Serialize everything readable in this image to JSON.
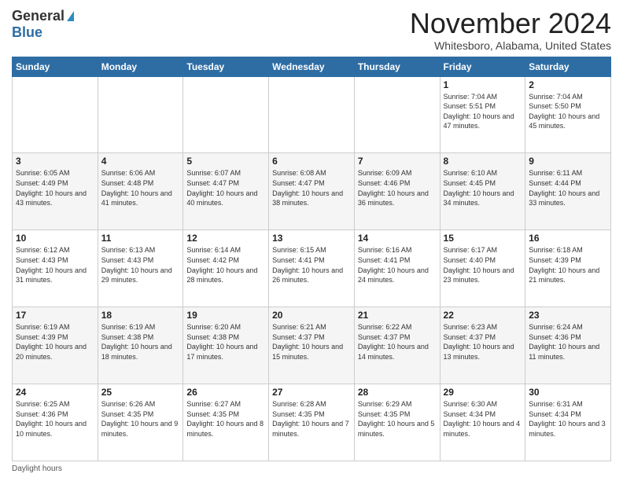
{
  "logo": {
    "line1": "General",
    "line2": "Blue"
  },
  "title": {
    "month_year": "November 2024",
    "location": "Whitesboro, Alabama, United States"
  },
  "days_of_week": [
    "Sunday",
    "Monday",
    "Tuesday",
    "Wednesday",
    "Thursday",
    "Friday",
    "Saturday"
  ],
  "footer": {
    "label": "Daylight hours"
  },
  "weeks": [
    [
      {
        "day": "",
        "sunrise": "",
        "sunset": "",
        "daylight": ""
      },
      {
        "day": "",
        "sunrise": "",
        "sunset": "",
        "daylight": ""
      },
      {
        "day": "",
        "sunrise": "",
        "sunset": "",
        "daylight": ""
      },
      {
        "day": "",
        "sunrise": "",
        "sunset": "",
        "daylight": ""
      },
      {
        "day": "",
        "sunrise": "",
        "sunset": "",
        "daylight": ""
      },
      {
        "day": "1",
        "sunrise": "Sunrise: 7:04 AM",
        "sunset": "Sunset: 5:51 PM",
        "daylight": "Daylight: 10 hours and 47 minutes."
      },
      {
        "day": "2",
        "sunrise": "Sunrise: 7:04 AM",
        "sunset": "Sunset: 5:50 PM",
        "daylight": "Daylight: 10 hours and 45 minutes."
      }
    ],
    [
      {
        "day": "3",
        "sunrise": "Sunrise: 6:05 AM",
        "sunset": "Sunset: 4:49 PM",
        "daylight": "Daylight: 10 hours and 43 minutes."
      },
      {
        "day": "4",
        "sunrise": "Sunrise: 6:06 AM",
        "sunset": "Sunset: 4:48 PM",
        "daylight": "Daylight: 10 hours and 41 minutes."
      },
      {
        "day": "5",
        "sunrise": "Sunrise: 6:07 AM",
        "sunset": "Sunset: 4:47 PM",
        "daylight": "Daylight: 10 hours and 40 minutes."
      },
      {
        "day": "6",
        "sunrise": "Sunrise: 6:08 AM",
        "sunset": "Sunset: 4:47 PM",
        "daylight": "Daylight: 10 hours and 38 minutes."
      },
      {
        "day": "7",
        "sunrise": "Sunrise: 6:09 AM",
        "sunset": "Sunset: 4:46 PM",
        "daylight": "Daylight: 10 hours and 36 minutes."
      },
      {
        "day": "8",
        "sunrise": "Sunrise: 6:10 AM",
        "sunset": "Sunset: 4:45 PM",
        "daylight": "Daylight: 10 hours and 34 minutes."
      },
      {
        "day": "9",
        "sunrise": "Sunrise: 6:11 AM",
        "sunset": "Sunset: 4:44 PM",
        "daylight": "Daylight: 10 hours and 33 minutes."
      }
    ],
    [
      {
        "day": "10",
        "sunrise": "Sunrise: 6:12 AM",
        "sunset": "Sunset: 4:43 PM",
        "daylight": "Daylight: 10 hours and 31 minutes."
      },
      {
        "day": "11",
        "sunrise": "Sunrise: 6:13 AM",
        "sunset": "Sunset: 4:43 PM",
        "daylight": "Daylight: 10 hours and 29 minutes."
      },
      {
        "day": "12",
        "sunrise": "Sunrise: 6:14 AM",
        "sunset": "Sunset: 4:42 PM",
        "daylight": "Daylight: 10 hours and 28 minutes."
      },
      {
        "day": "13",
        "sunrise": "Sunrise: 6:15 AM",
        "sunset": "Sunset: 4:41 PM",
        "daylight": "Daylight: 10 hours and 26 minutes."
      },
      {
        "day": "14",
        "sunrise": "Sunrise: 6:16 AM",
        "sunset": "Sunset: 4:41 PM",
        "daylight": "Daylight: 10 hours and 24 minutes."
      },
      {
        "day": "15",
        "sunrise": "Sunrise: 6:17 AM",
        "sunset": "Sunset: 4:40 PM",
        "daylight": "Daylight: 10 hours and 23 minutes."
      },
      {
        "day": "16",
        "sunrise": "Sunrise: 6:18 AM",
        "sunset": "Sunset: 4:39 PM",
        "daylight": "Daylight: 10 hours and 21 minutes."
      }
    ],
    [
      {
        "day": "17",
        "sunrise": "Sunrise: 6:19 AM",
        "sunset": "Sunset: 4:39 PM",
        "daylight": "Daylight: 10 hours and 20 minutes."
      },
      {
        "day": "18",
        "sunrise": "Sunrise: 6:19 AM",
        "sunset": "Sunset: 4:38 PM",
        "daylight": "Daylight: 10 hours and 18 minutes."
      },
      {
        "day": "19",
        "sunrise": "Sunrise: 6:20 AM",
        "sunset": "Sunset: 4:38 PM",
        "daylight": "Daylight: 10 hours and 17 minutes."
      },
      {
        "day": "20",
        "sunrise": "Sunrise: 6:21 AM",
        "sunset": "Sunset: 4:37 PM",
        "daylight": "Daylight: 10 hours and 15 minutes."
      },
      {
        "day": "21",
        "sunrise": "Sunrise: 6:22 AM",
        "sunset": "Sunset: 4:37 PM",
        "daylight": "Daylight: 10 hours and 14 minutes."
      },
      {
        "day": "22",
        "sunrise": "Sunrise: 6:23 AM",
        "sunset": "Sunset: 4:37 PM",
        "daylight": "Daylight: 10 hours and 13 minutes."
      },
      {
        "day": "23",
        "sunrise": "Sunrise: 6:24 AM",
        "sunset": "Sunset: 4:36 PM",
        "daylight": "Daylight: 10 hours and 11 minutes."
      }
    ],
    [
      {
        "day": "24",
        "sunrise": "Sunrise: 6:25 AM",
        "sunset": "Sunset: 4:36 PM",
        "daylight": "Daylight: 10 hours and 10 minutes."
      },
      {
        "day": "25",
        "sunrise": "Sunrise: 6:26 AM",
        "sunset": "Sunset: 4:35 PM",
        "daylight": "Daylight: 10 hours and 9 minutes."
      },
      {
        "day": "26",
        "sunrise": "Sunrise: 6:27 AM",
        "sunset": "Sunset: 4:35 PM",
        "daylight": "Daylight: 10 hours and 8 minutes."
      },
      {
        "day": "27",
        "sunrise": "Sunrise: 6:28 AM",
        "sunset": "Sunset: 4:35 PM",
        "daylight": "Daylight: 10 hours and 7 minutes."
      },
      {
        "day": "28",
        "sunrise": "Sunrise: 6:29 AM",
        "sunset": "Sunset: 4:35 PM",
        "daylight": "Daylight: 10 hours and 5 minutes."
      },
      {
        "day": "29",
        "sunrise": "Sunrise: 6:30 AM",
        "sunset": "Sunset: 4:34 PM",
        "daylight": "Daylight: 10 hours and 4 minutes."
      },
      {
        "day": "30",
        "sunrise": "Sunrise: 6:31 AM",
        "sunset": "Sunset: 4:34 PM",
        "daylight": "Daylight: 10 hours and 3 minutes."
      }
    ]
  ]
}
